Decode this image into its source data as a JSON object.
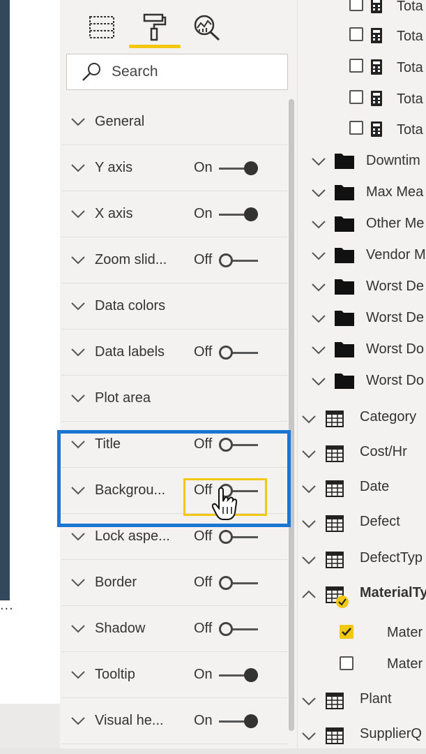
{
  "format_pane": {
    "tabs": [
      {
        "name": "fields",
        "icon": "fields-grid-icon"
      },
      {
        "name": "format",
        "icon": "paint-roller-icon",
        "active": true
      },
      {
        "name": "analytics",
        "icon": "analytics-magnifier-icon"
      }
    ],
    "search": {
      "placeholder": "Search"
    },
    "sections": [
      {
        "label": "General",
        "state": "",
        "toggle": null
      },
      {
        "label": "Y axis",
        "state": "On",
        "toggle": "on"
      },
      {
        "label": "X axis",
        "state": "On",
        "toggle": "on"
      },
      {
        "label": "Zoom slid...",
        "state": "Off",
        "toggle": "off"
      },
      {
        "label": "Data colors",
        "state": "",
        "toggle": null
      },
      {
        "label": "Data labels",
        "state": "Off",
        "toggle": "off"
      },
      {
        "label": "Plot area",
        "state": "",
        "toggle": null
      },
      {
        "label": "Title",
        "state": "Off",
        "toggle": "off"
      },
      {
        "label": "Backgrou...",
        "state": "Off",
        "toggle": "off"
      },
      {
        "label": "Lock aspe...",
        "state": "Off",
        "toggle": "off"
      },
      {
        "label": "Border",
        "state": "Off",
        "toggle": "off"
      },
      {
        "label": "Shadow",
        "state": "Off",
        "toggle": "off"
      },
      {
        "label": "Tooltip",
        "state": "On",
        "toggle": "on"
      },
      {
        "label": "Visual he...",
        "state": "On",
        "toggle": "on"
      }
    ]
  },
  "fields_pane": {
    "measures": [
      "Tota",
      "Tota",
      "Tota",
      "Tota",
      "Tota"
    ],
    "folders": [
      "Downtim",
      "Max Mea",
      "Other Me",
      "Vendor M",
      "Worst De",
      "Worst De",
      "Worst Do",
      "Worst Do"
    ],
    "tables": [
      {
        "label": "Category",
        "expanded": false
      },
      {
        "label": "Cost/Hr",
        "expanded": false
      },
      {
        "label": "Date",
        "expanded": false
      },
      {
        "label": "Defect",
        "expanded": false
      },
      {
        "label": "DefectTyp",
        "expanded": false
      },
      {
        "label": "MaterialTy",
        "expanded": true,
        "bold": true
      },
      {
        "label": "Plant",
        "expanded": false
      },
      {
        "label": "SupplierQ",
        "expanded": false
      }
    ],
    "material_fields": [
      {
        "label": "Mater",
        "checked": true
      },
      {
        "label": "Mater",
        "checked": false
      }
    ]
  },
  "canvas": {
    "overflow_dots": "..."
  },
  "colors": {
    "accent_yellow": "#f2c811",
    "highlight_blue": "#1c75d0",
    "pane_bg": "#f3f2f1"
  }
}
